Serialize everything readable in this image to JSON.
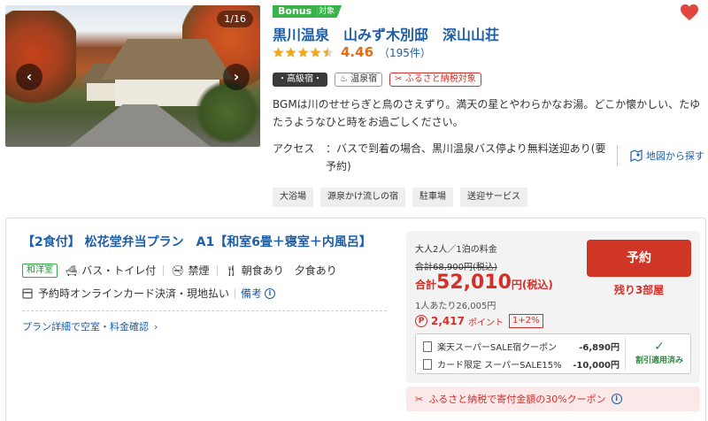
{
  "gallery": {
    "counter": "1/16"
  },
  "bonus": {
    "label": "Bonus",
    "tag": "対象"
  },
  "hotel": {
    "name": "黒川温泉　山みず木別邸　深山山荘",
    "score": "4.46",
    "reviews": "（195件）",
    "stars": 4.5
  },
  "badges": [
    "・高級宿・",
    "温泉宿",
    "ふるさと納税対象"
  ],
  "description": "BGMは川のせせらぎと鳥のさえずり。満天の星とやわらかなお湯。どこか懐かしい、たゆたうようなひと時をお過ごしください。",
  "access": {
    "label": "アクセス",
    "text": "：バスで到着の場合、黒川温泉バス停より無料送迎あり(要予約)"
  },
  "map_link": "地図から探す",
  "tags": [
    "大浴場",
    "源泉かけ流しの宿",
    "駐車場",
    "送迎サービス"
  ],
  "plan": {
    "title": "【2食付】 松花堂弁当プラン　A1【和室6畳＋寝室＋内風呂】",
    "room_type": "和洋室",
    "amenities": [
      "バス・トイレ付",
      "禁煙",
      "朝食あり",
      "夕食あり"
    ],
    "payment": "予約時オンラインカード決済・現地払い",
    "payment_note": "備考",
    "detail_link": "プラン詳細で空室・料金確認"
  },
  "price": {
    "guests": "大人2人／1泊の料金",
    "original": "合計68,900円(税込)",
    "total_prefix": "合計",
    "total": "52,010",
    "total_suffix": "円(税込)",
    "per_person": "1人あたり26,005円",
    "points": "2,417",
    "points_label": "ポイント",
    "points_multiplier": "1+2%",
    "reserve_button": "予約",
    "rooms_left": "残り3部屋"
  },
  "coupons": [
    {
      "name": "楽天スーパーSALE宿クーポン",
      "amount": "-6,890円"
    },
    {
      "name": "カード限定 スーパーSALE15%…",
      "amount": "-10,000円"
    }
  ],
  "coupon_status": "割引適用済み",
  "furusato_banner": "ふるさと納税で寄付金額の30%クーポン",
  "colors": {
    "brand_blue": "#1d5ea8",
    "accent_red": "#cf3625",
    "star_orange": "#f0a81c",
    "bonus_green": "#37b34a"
  }
}
